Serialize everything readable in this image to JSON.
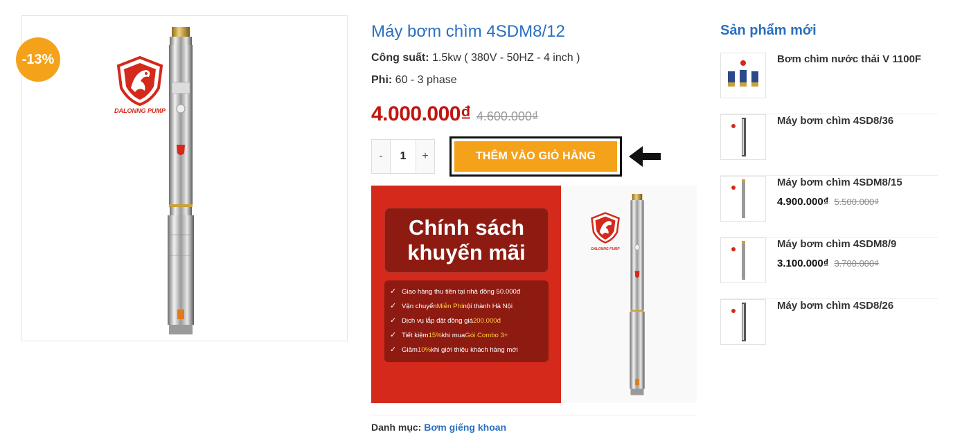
{
  "product": {
    "title": "Máy bơm chìm 4SDM8/12",
    "sale_badge": "-13%",
    "brand": "DALONNG PUMP",
    "specs": [
      {
        "label": "Công suất:",
        "value": " 1.5kw ( 380V - 50HZ - 4 inch )"
      },
      {
        "label": "Phi:",
        "value": " 60 - 3 phase"
      }
    ],
    "price_now": "4.000.000₫",
    "price_old": "4.600.000₫",
    "quantity": "1",
    "qty_minus": "-",
    "qty_plus": "+",
    "add_to_cart": "THÊM VÀO GIỎ HÀNG",
    "category_label": "Danh mục:",
    "category_link": "Bơm giếng khoan"
  },
  "promo": {
    "title_line1": "Chính sách",
    "title_line2": "khuyến mãi",
    "items": [
      {
        "pre": "Giao hàng thu tiền tại nhà đồng 50.000đ",
        "hl": "",
        "post": ""
      },
      {
        "pre": "Vận chuyển ",
        "hl": "Miễn Phí",
        "post": " nội thành Hà Nội"
      },
      {
        "pre": "Dịch vụ lắp đặt đồng giá ",
        "hl": "200.000đ",
        "post": ""
      },
      {
        "pre": "Tiết kiệm ",
        "hl": "15%",
        "post": " khi mua ",
        "hl2": "Gói Combo 3+"
      },
      {
        "pre": "Giảm ",
        "hl": "10%",
        "post": " khi giới thiệu khách hàng mới"
      }
    ],
    "brand": "DALONNG PUMP"
  },
  "sidebar": {
    "title": "Sản phẩm mới",
    "items": [
      {
        "name": "Bơm chìm nước thải V 1100F",
        "price_now": "",
        "price_old": ""
      },
      {
        "name": "Máy bơm chìm 4SD8/36",
        "price_now": "",
        "price_old": ""
      },
      {
        "name": "Máy bơm chìm 4SDM8/15",
        "price_now": "4.900.000₫",
        "price_old": "5.500.000₫"
      },
      {
        "name": "Máy bơm chìm 4SDM8/9",
        "price_now": "3.100.000₫",
        "price_old": "3.700.000₫"
      },
      {
        "name": "Máy bơm chìm 4SD8/26",
        "price_now": "",
        "price_old": ""
      }
    ]
  },
  "colors": {
    "accent_blue": "#2a6fc0",
    "price_red": "#c0160f",
    "button_orange": "#f5a21b",
    "promo_red": "#d4291b",
    "highlight_yellow": "#ffd23f"
  }
}
